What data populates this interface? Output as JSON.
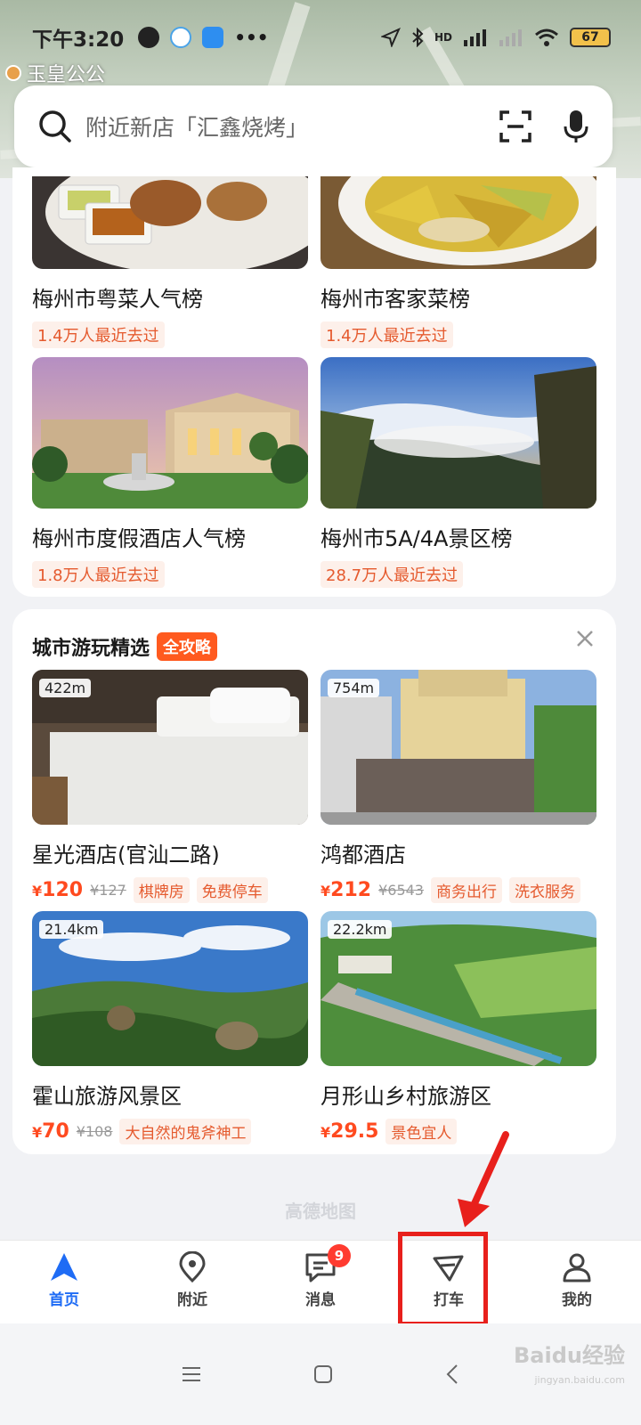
{
  "status_bar": {
    "time": "下午3:20",
    "network": "HD",
    "battery": "67",
    "more": "•••"
  },
  "map": {
    "place_label": "玉皇公公"
  },
  "search": {
    "placeholder": "附近新店「汇鑫烧烤」"
  },
  "rankings": [
    {
      "title": "梅州市粤菜人气榜",
      "visits": "1.4万人最近去过"
    },
    {
      "title": "梅州市客家菜榜",
      "visits": "1.4万人最近去过"
    },
    {
      "title": "梅州市度假酒店人气榜",
      "visits": "1.8万人最近去过"
    },
    {
      "title": "梅州市5A/4A景区榜",
      "visits": "28.7万人最近去过"
    }
  ],
  "city_section": {
    "title": "城市游玩精选",
    "tag": "全攻略",
    "items": [
      {
        "distance": "422m",
        "name": "星光酒店(官汕二路)",
        "currency": "¥",
        "price": "120",
        "old_price": "¥127",
        "tags": [
          "棋牌房",
          "免费停车"
        ]
      },
      {
        "distance": "754m",
        "name": "鸿都酒店",
        "currency": "¥",
        "price": "212",
        "old_price": "¥6543",
        "tags": [
          "商务出行",
          "洗衣服务"
        ]
      },
      {
        "distance": "21.4km",
        "name": "霍山旅游风景区",
        "currency": "¥",
        "price": "70",
        "old_price": "¥108",
        "tags": [
          "大自然的鬼斧神工"
        ]
      },
      {
        "distance": "22.2km",
        "name": "月形山乡村旅游区",
        "currency": "¥",
        "price": "29.5",
        "old_price": "",
        "tags": [
          "景色宜人"
        ]
      }
    ]
  },
  "footer_brand": "高德地图",
  "tabs": [
    {
      "label": "首页"
    },
    {
      "label": "附近"
    },
    {
      "label": "消息",
      "badge": "9"
    },
    {
      "label": "打车"
    },
    {
      "label": "我的"
    }
  ],
  "watermark": {
    "main": "Baidu经验",
    "sub": "jingyan.baidu.com"
  },
  "colors": {
    "accent": "#1f6cf5",
    "price": "#ff4a1f",
    "highlight": "#e8201c",
    "tag_bg": "#fdf0ea"
  }
}
